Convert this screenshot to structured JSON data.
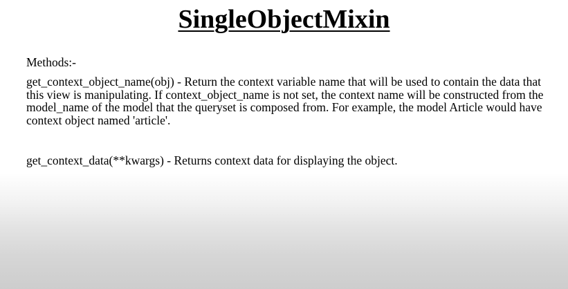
{
  "slide": {
    "title": "SingleObjectMixin",
    "section_label": "Methods:-",
    "methods": [
      {
        "text": "get_context_object_name(obj) - Return the context variable name that will be used to contain the data that this view is manipulating. If context_object_name is not set, the context name will be constructed from the model_name of the model that the queryset is composed from. For example, the model Article would have context object named 'article'."
      },
      {
        "text": "get_context_data(**kwargs) - Returns context data for displaying the object."
      }
    ]
  },
  "icons": {
    "cursor": "text-cursor-icon"
  },
  "colors": {
    "text": "#000000",
    "background_top": "#ffffff",
    "background_bottom": "#cdcdcd"
  }
}
